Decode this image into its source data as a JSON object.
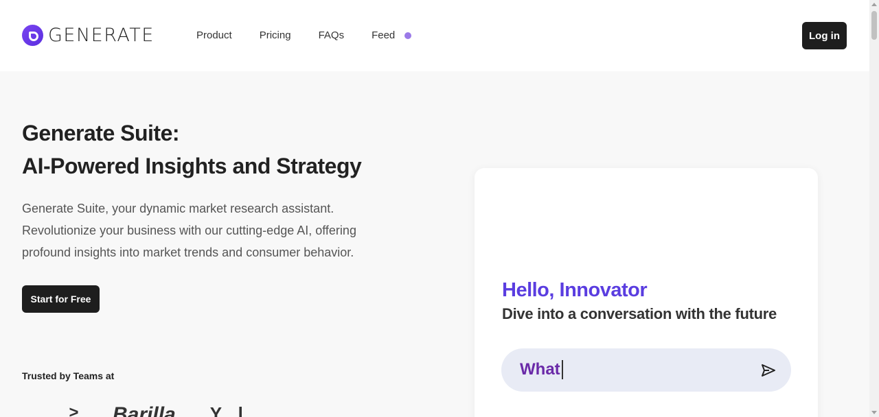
{
  "header": {
    "logo_text": "GENERATE",
    "nav": [
      "Product",
      "Pricing",
      "FAQs",
      "Feed"
    ],
    "login_label": "Log in"
  },
  "hero": {
    "title_line1": "Generate Suite:",
    "title_line2": "AI-Powered Insights and Strategy",
    "description": "Generate Suite, your dynamic market research assistant. Revolutionize your business with our cutting-edge AI, offering profound insights into market trends and consumer behavior.",
    "cta_label": "Start for Free",
    "trusted_label": "Trusted by Teams at",
    "brands": [
      ">",
      "Barilla",
      "Y..l.."
    ]
  },
  "chat": {
    "greeting": "Hello, Innovator",
    "subtitle": "Dive into a conversation with the future",
    "input_value": "What"
  },
  "colors": {
    "accent": "#5a3de0",
    "feed_dot": "#9b7ae8",
    "dark_button": "#1e1e1e",
    "input_bg": "#e8ebf5"
  },
  "icons": {
    "logo": "generate-logo-icon",
    "send": "send-icon",
    "feed_indicator": "status-dot-icon"
  }
}
